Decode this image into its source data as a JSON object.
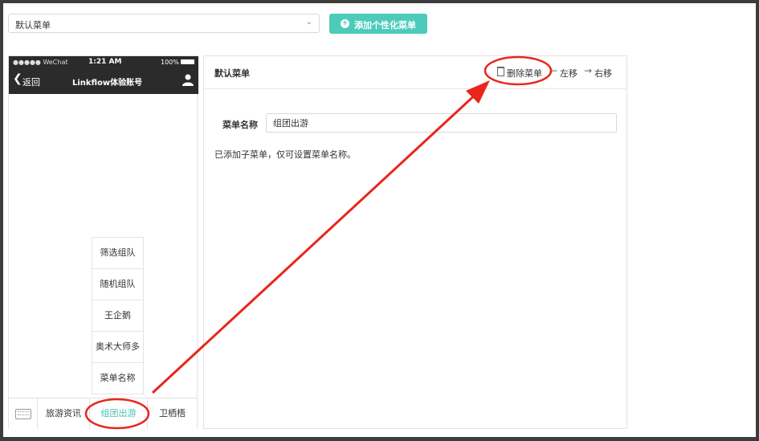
{
  "top_bar": {
    "menu_select_value": "默认菜单",
    "add_button_label": "添加个性化菜单"
  },
  "phone": {
    "status": {
      "carrier": "●●●●● WeChat",
      "time": "1:21 AM",
      "battery": "100%"
    },
    "nav": {
      "back_label": "返回",
      "title": "Linkflow体验账号"
    },
    "submenu_items": [
      "筛选组队",
      "随机组队",
      "王企鹅",
      "奥术大师多",
      "菜单名称"
    ],
    "tabs": [
      "旅游资讯",
      "组团出游",
      "卫栖梧"
    ],
    "active_tab": "组团出游"
  },
  "panel": {
    "title": "默认菜单",
    "actions": {
      "delete_label": "删除菜单",
      "move_left_label": "左移",
      "move_right_label": "右移"
    },
    "field_label": "菜单名称",
    "field_value": "组团出游",
    "hint": "已添加子菜单，仅可设置菜单名称。"
  },
  "colors": {
    "accent": "#4ccbbb",
    "annotation": "#e8261c",
    "phone_header": "#2b2b2b"
  }
}
